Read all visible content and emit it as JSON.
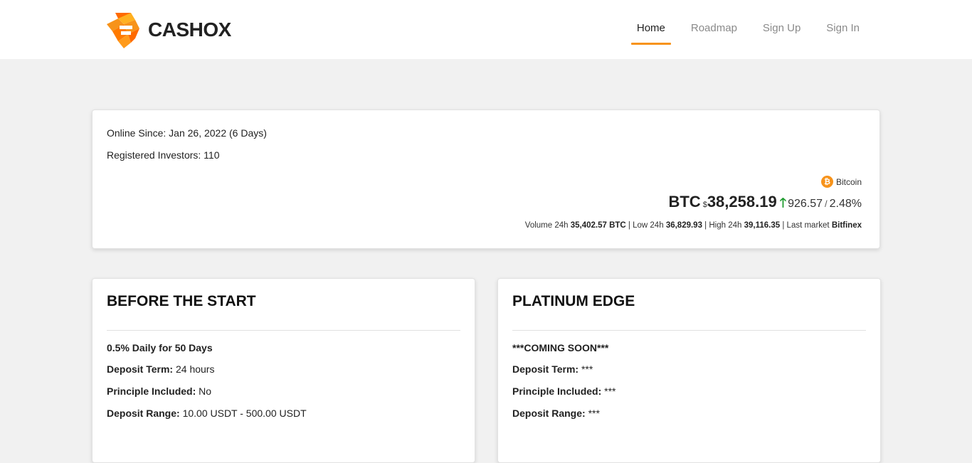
{
  "brand": {
    "name_part1": "CASH",
    "name_part2": "OX",
    "logo_colors": [
      "#f7931a",
      "#ff6a00"
    ]
  },
  "nav": {
    "items": [
      {
        "label": "Home",
        "active": true
      },
      {
        "label": "Roadmap",
        "active": false
      },
      {
        "label": "Sign Up",
        "active": false
      },
      {
        "label": "Sign In",
        "active": false
      }
    ],
    "accent_color": "#f7931a"
  },
  "stats": {
    "online_since": "Online Since: Jan 26, 2022 (6 Days)",
    "registered_investors": "Registered Investors: 110"
  },
  "btc": {
    "coin_icon": "bitcoin-icon",
    "coin_icon_glyph": "₿",
    "coin_name": "Bitcoin",
    "symbol": "BTC",
    "currency": "$",
    "price": "38,258.19",
    "change_arrow": "🡑",
    "change": "926.57",
    "change_sep": "/",
    "change_pct": "2.48%",
    "volume_label": "Volume 24h",
    "volume_value": "35,402.57 BTC",
    "low_label": "Low 24h",
    "low_value": "36,829.93",
    "high_label": "High 24h",
    "high_value": "39,116.35",
    "market_label": "Last market",
    "market_value": "Bitfinex",
    "up_color": "#1c9a2c"
  },
  "plans": [
    {
      "title": "BEFORE THE START",
      "headline": "0.5% Daily for 50 Days",
      "rows": [
        {
          "label": "Deposit Term:",
          "value": "24 hours"
        },
        {
          "label": "Principle Included:",
          "value": "No"
        },
        {
          "label": "Deposit Range:",
          "value": "10.00 USDT - 500.00 USDT"
        }
      ]
    },
    {
      "title": "PLATINUM EDGE",
      "headline": "***COMING SOON***",
      "rows": [
        {
          "label": "Deposit Term:",
          "value": "***"
        },
        {
          "label": "Principle Included:",
          "value": "***"
        },
        {
          "label": "Deposit Range:",
          "value": "***"
        }
      ]
    }
  ]
}
